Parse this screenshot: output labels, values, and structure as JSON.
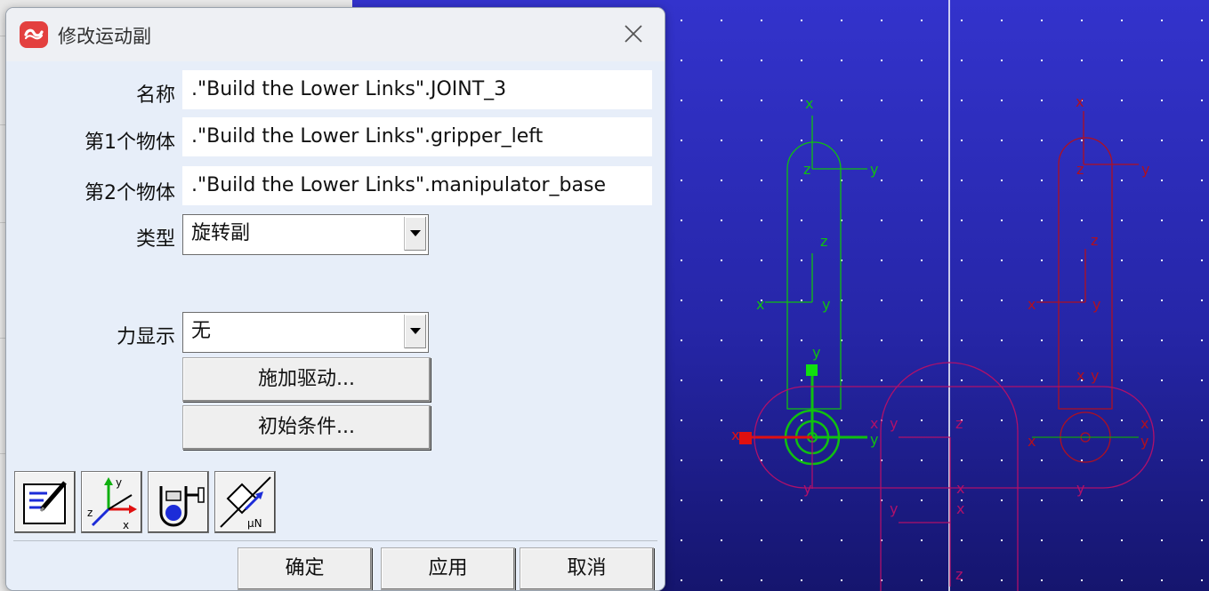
{
  "dialog": {
    "title": "修改运动副",
    "app_icon": "adams-logo-icon",
    "close_icon": "close-icon"
  },
  "form": {
    "name_label": "名称",
    "name_value": ".\"Build the Lower Links\".JOINT_3",
    "body1_label": "第1个物体",
    "body1_value": ".\"Build the Lower Links\".gripper_left",
    "body2_label": "第2个物体",
    "body2_value": ".\"Build the Lower Links\".manipulator_base",
    "type_label": "类型",
    "type_value": "旋转副",
    "force_label": "力显示",
    "force_value": "无"
  },
  "buttons": {
    "impose_motion": "施加驱动...",
    "initial_conditions": "初始条件...",
    "ok": "确定",
    "apply": "应用",
    "cancel": "取消"
  },
  "toolbar": [
    {
      "icon": "edit-notes-icon"
    },
    {
      "icon": "coordinate-axes-icon"
    },
    {
      "icon": "joint-clamp-icon"
    },
    {
      "icon": "friction-icon"
    }
  ],
  "viewport": {
    "background": "#2a2ab0",
    "green_part": "#00c800",
    "red_part": "#b01020",
    "magenta_part": "#b0106a",
    "axis_labels": {
      "x": "x",
      "y": "y",
      "z": "z"
    }
  }
}
